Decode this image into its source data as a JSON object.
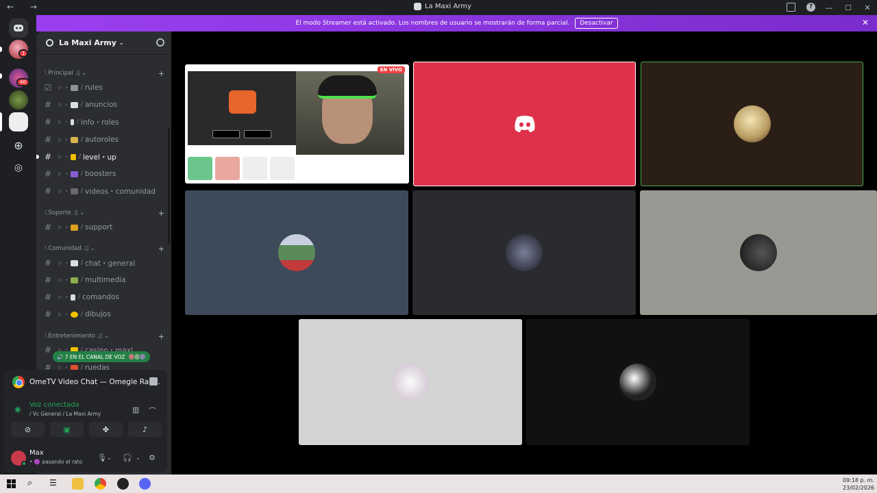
{
  "window": {
    "title": "La Maxi Army",
    "nav": "← →",
    "controls": [
      "—",
      "☐",
      "✕"
    ]
  },
  "streamer_bar": {
    "message": "El modo Streamer está activado. Los nombres de usuario se mostrarán de forma parcial.",
    "button": "Desactivar",
    "close": "✕"
  },
  "servers": {
    "badges": [
      "1",
      "40"
    ]
  },
  "guild": {
    "name": "La Maxi Army",
    "caret": "⌄"
  },
  "categories": [
    {
      "label": "⁝.Principal .▯ ⌄",
      "plus": "+"
    },
    {
      "label": "⁝.Soporte .▯ ⌄",
      "plus": "+"
    },
    {
      "label": "⁝.Comunidad .▯ ⌄",
      "plus": "+"
    },
    {
      "label": "⁝.Entretenimiento .▯ ⌄",
      "plus": "+"
    }
  ],
  "channels": [
    {
      "name": "rules",
      "color": "#8e9297"
    },
    {
      "name": "anuncios",
      "color": "#dbdee1"
    },
    {
      "name": "info・roles",
      "color": "#dbdee1"
    },
    {
      "name": "autoroles",
      "color": "#d4b24c"
    },
    {
      "name": "level・up",
      "color": "#f0c000"
    },
    {
      "name": "boosters",
      "color": "#8a5cd6"
    },
    {
      "name": "videos・comunidad",
      "color": "#6a6a6a"
    },
    {
      "name": "support",
      "color": "#e0a020"
    },
    {
      "name": "chat・general",
      "color": "#dbdee1"
    },
    {
      "name": "multimedia",
      "color": "#8ab04c"
    },
    {
      "name": "comandos",
      "color": "#dbdee1"
    },
    {
      "name": "dibujos",
      "color": "#f0c000"
    },
    {
      "name": "casino・maxi",
      "color": "#f0c000"
    },
    {
      "name": "ruedas",
      "color": "#e05030"
    }
  ],
  "voice_pill": "🔊 7 EN EL CANAL DE VOZ",
  "activity": {
    "title": "OmeTV Video Chat — Omegle Ran..."
  },
  "voice": {
    "status": "Voz conectada",
    "channel": "/ Vc General / La Maxi Army"
  },
  "user": {
    "name": "Max",
    "status": "• 🟣 pasando el rato"
  },
  "stream": {
    "live_label": "EN VIVO"
  },
  "clock": {
    "time": "09:18 p. m.",
    "date": "23/02/2026"
  },
  "colors": {
    "streamer_bar": "#9a3ff0",
    "discord_tile": "#dd3249",
    "voice_green": "#23a55a"
  }
}
